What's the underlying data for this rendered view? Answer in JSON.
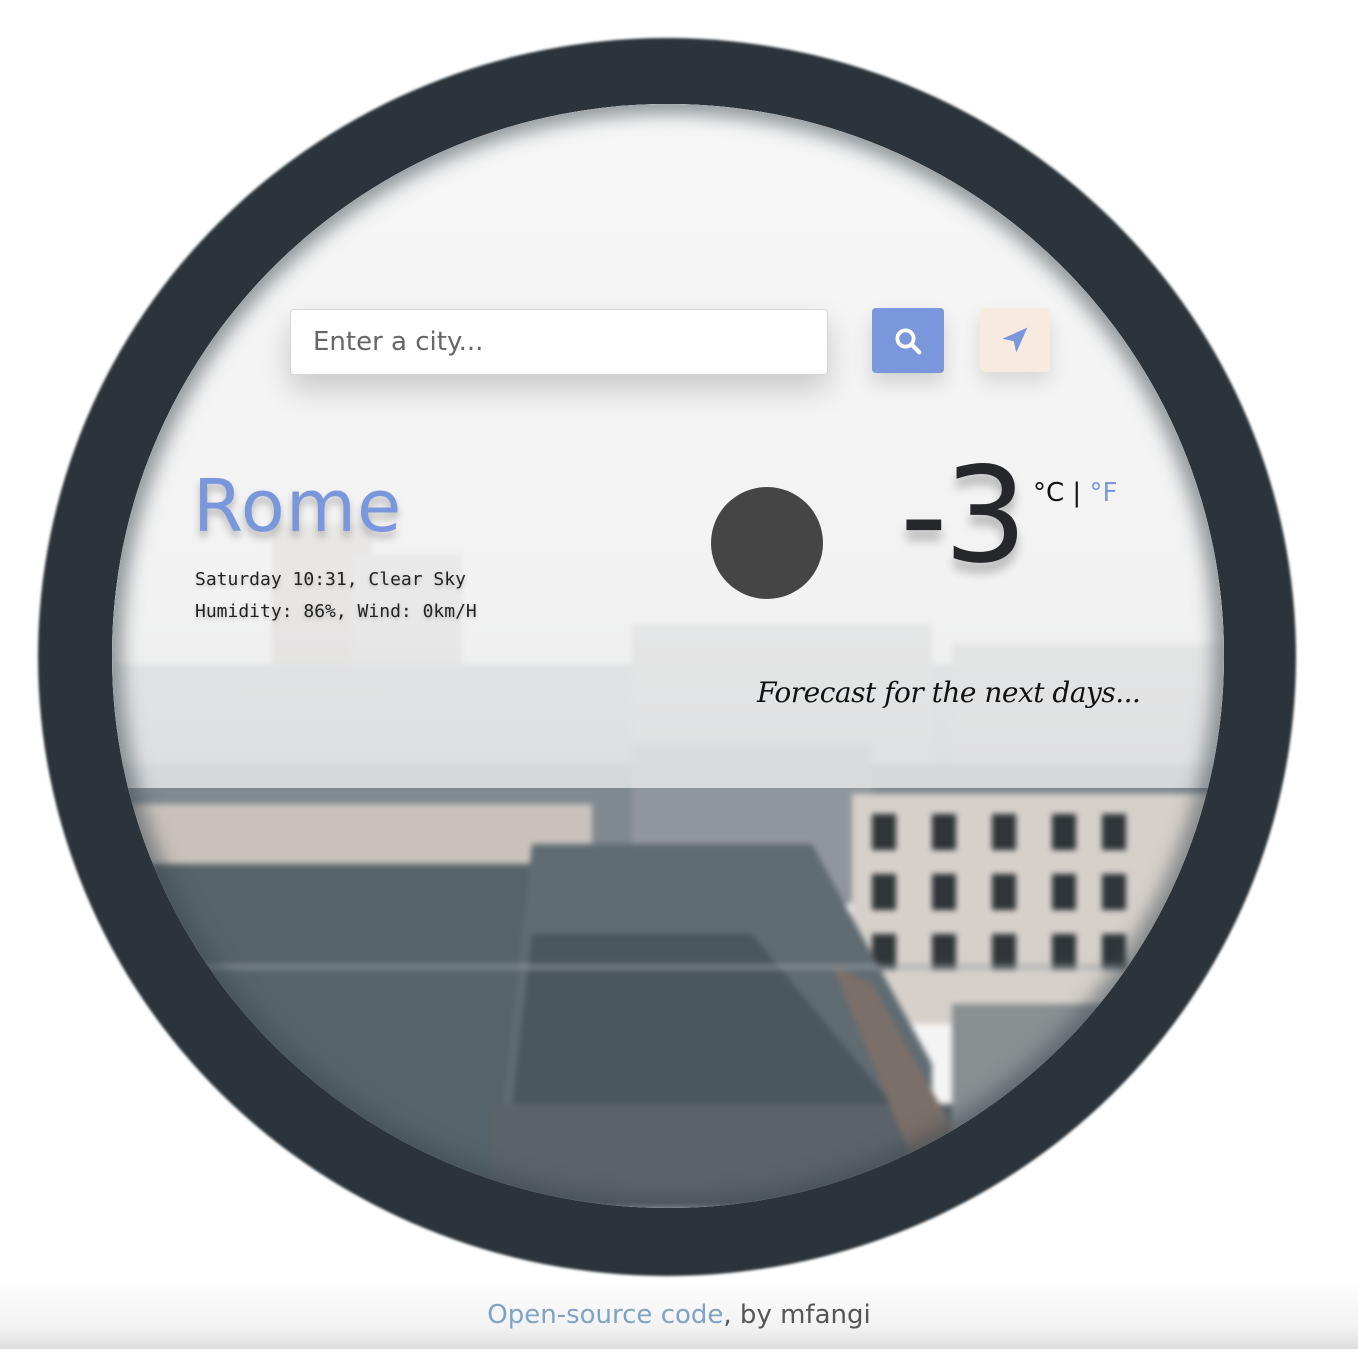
{
  "search": {
    "placeholder": "Enter a city..."
  },
  "icons": {
    "search": "search-icon",
    "location": "location-arrow-icon",
    "weather": "clear-sky-icon"
  },
  "colors": {
    "accent": "#7b97db",
    "location_button_bg": "#f6ebde",
    "link": "#7fa3c6"
  },
  "city": {
    "name": "Rome",
    "description": "Saturday 10:31, Clear Sky",
    "details": "Humidity: 86%, Wind: 0km/H"
  },
  "temperature": {
    "value": "-3",
    "unit_celsius": "°C",
    "separator": "|",
    "unit_fahrenheit": "°F"
  },
  "forecast": {
    "heading": "Forecast for the next days..."
  },
  "footer": {
    "link_text": "Open-source code",
    "suffix": ", by mfangi"
  }
}
